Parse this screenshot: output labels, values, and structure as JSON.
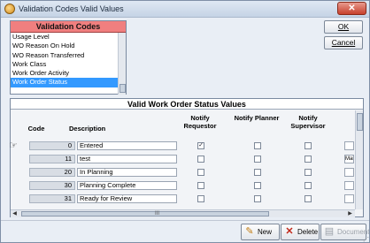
{
  "window": {
    "title": "Validation Codes Valid Values",
    "close_label": "✕"
  },
  "validation_codes": {
    "header": "Validation Codes",
    "items": [
      "Usage Level",
      "WO Reason On Hold",
      "WO Reason Transferred",
      "Work Class",
      "Work Order Activity",
      "Work Order Status"
    ],
    "selected_index": 5
  },
  "buttons": {
    "ok": "OK",
    "cancel": "Cancel",
    "new": "New",
    "delete": "Delete",
    "documents": "Documents"
  },
  "grid": {
    "title": "Valid Work Order Status Values",
    "headers": {
      "code": "Code",
      "description": "Description",
      "notify_requestor": "Notify Requestor",
      "notify_planner": "Notify Planner",
      "notify_supervisor": "Notify Supervisor"
    },
    "rows": [
      {
        "code": "0",
        "description": "Entered",
        "notify_requestor": true,
        "notify_planner": false,
        "notify_supervisor": false,
        "extra": ""
      },
      {
        "code": "11",
        "description": "test",
        "notify_requestor": false,
        "notify_planner": false,
        "notify_supervisor": false,
        "extra": "Main"
      },
      {
        "code": "20",
        "description": "In Planning",
        "notify_requestor": false,
        "notify_planner": false,
        "notify_supervisor": false,
        "extra": ""
      },
      {
        "code": "30",
        "description": "Planning Complete",
        "notify_requestor": false,
        "notify_planner": false,
        "notify_supervisor": false,
        "extra": ""
      },
      {
        "code": "31",
        "description": "Ready for Review",
        "notify_requestor": false,
        "notify_planner": false,
        "notify_supervisor": false,
        "extra": ""
      }
    ],
    "scroll_grip": "III"
  },
  "colors": {
    "header_red": "#f07f7f",
    "selection_blue": "#3399ff"
  }
}
